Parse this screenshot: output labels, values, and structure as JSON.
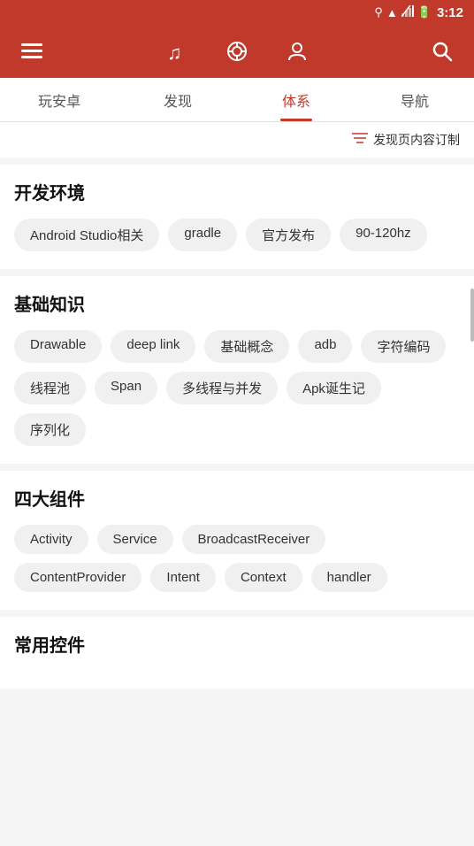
{
  "statusBar": {
    "time": "3:12",
    "icons": [
      "location",
      "wifi",
      "signal",
      "battery"
    ]
  },
  "topNav": {
    "menuIcon": "☰",
    "musicIcon": "♪",
    "cloudIcon": "ȸ",
    "userIcon": "👤",
    "searchIcon": "🔍"
  },
  "tabs": [
    {
      "id": "wananzuo",
      "label": "玩安卓",
      "active": false
    },
    {
      "id": "faxian",
      "label": "发现",
      "active": false
    },
    {
      "id": "tixi",
      "label": "体系",
      "active": true
    },
    {
      "id": "daohang",
      "label": "导航",
      "active": false
    }
  ],
  "filterBar": {
    "icon": "⊟",
    "text": "发现页内容订制"
  },
  "sections": [
    {
      "id": "dev-env",
      "title": "开发环境",
      "tags": [
        "Android Studio相关",
        "gradle",
        "官方发布",
        "90-120hz"
      ]
    },
    {
      "id": "basic-knowledge",
      "title": "基础知识",
      "tags": [
        "Drawable",
        "deep link",
        "基础概念",
        "adb",
        "字符编码",
        "线程池",
        "Span",
        "多线程与并发",
        "Apk诞生记",
        "序列化"
      ]
    },
    {
      "id": "four-components",
      "title": "四大组件",
      "tags": [
        "Activity",
        "Service",
        "BroadcastReceiver",
        "ContentProvider",
        "Intent",
        "Context",
        "handler"
      ]
    },
    {
      "id": "common-controls",
      "title": "常用控件",
      "tags": []
    }
  ]
}
